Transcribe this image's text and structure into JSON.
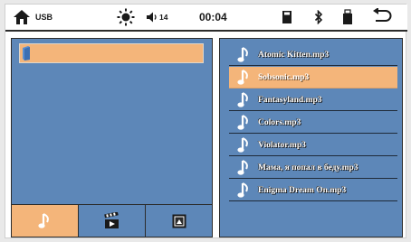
{
  "status": {
    "source_label": "USB",
    "volume": "14",
    "time": "00:04"
  },
  "playlist": {
    "tracks": [
      "Atomic Kitten.mp3",
      "Sobsonic.mp3",
      "Fantasyland.mp3",
      "Colors.mp3",
      "Violator.mp3",
      "Мама, я попал в беду.mp3",
      "Enigma Dream On.mp3"
    ],
    "selected_index": 1
  },
  "colors": {
    "panel": "#5d87b8",
    "highlight": "#f4b57a",
    "status_bar": "#ffffff"
  },
  "icons": {
    "home": "home-icon",
    "brightness": "brightness-icon",
    "volume": "speaker-icon",
    "sd_card": "sd-card-icon",
    "bluetooth": "bluetooth-icon",
    "usb": "usb-drive-icon",
    "back": "back-arrow-icon",
    "folder": "folder-icon",
    "music_tab": "music-note-icon",
    "video_tab": "clapperboard-icon",
    "image_tab": "image-icon"
  }
}
